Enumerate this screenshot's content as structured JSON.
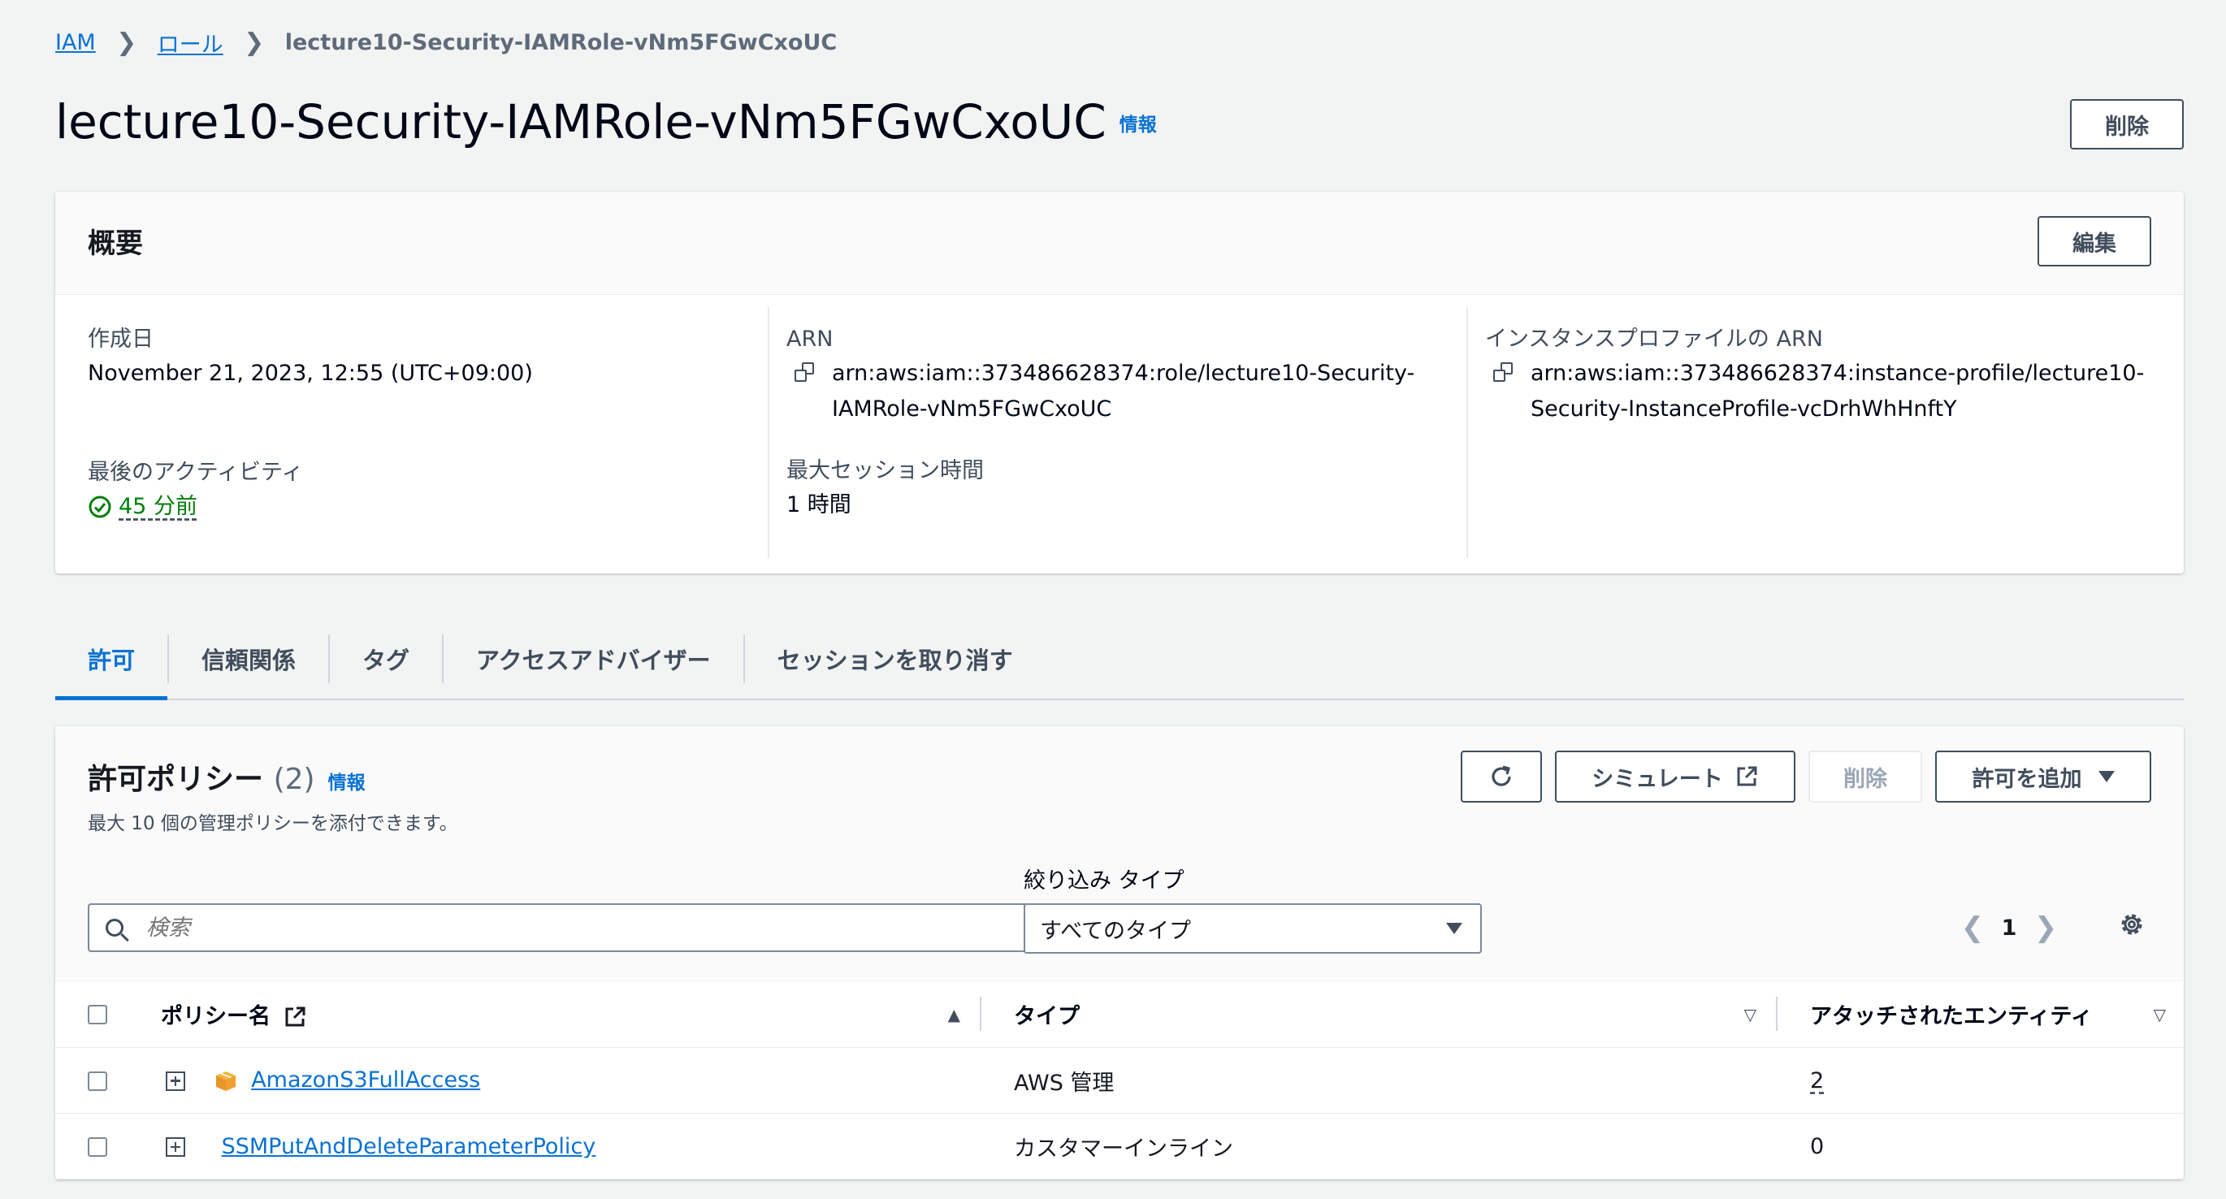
{
  "breadcrumb": {
    "items": [
      "IAM",
      "ロール"
    ],
    "current": "lecture10-Security-IAMRole-vNm5FGwCxoUC"
  },
  "page": {
    "title": "lecture10-Security-IAMRole-vNm5FGwCxoUC",
    "info": "情報",
    "delete_label": "削除"
  },
  "summary": {
    "title": "概要",
    "edit_label": "編集",
    "created_label": "作成日",
    "created_value": "November 21, 2023, 12:55 (UTC+09:00)",
    "last_activity_label": "最後のアクティビティ",
    "last_activity_value": "45 分前",
    "arn_label": "ARN",
    "arn_line1": "arn:aws:iam::373486628374:role/lecture10-Security-",
    "arn_line2": "IAMRole-vNm5FGwCxoUC",
    "max_session_label": "最大セッション時間",
    "max_session_value": "1 時間",
    "instance_arn_label": "インスタンスプロファイルの ARN",
    "instance_arn_line1": "arn:aws:iam::373486628374:instance-profile/lecture10-",
    "instance_arn_line2": "Security-InstanceProfile-vcDrhWhHnftY"
  },
  "tabs": [
    "許可",
    "信頼関係",
    "タグ",
    "アクセスアドバイザー",
    "セッションを取り消す"
  ],
  "policies": {
    "title": "許可ポリシー",
    "count": "(2)",
    "info": "情報",
    "description": "最大 10 個の管理ポリシーを添付できます。",
    "simulate_label": "シミュレート",
    "delete_label": "削除",
    "add_label": "許可を追加",
    "search_placeholder": "検索",
    "filter_label": "絞り込み タイプ",
    "filter_value": "すべてのタイプ",
    "page": "1",
    "columns": {
      "name": "ポリシー名",
      "type": "タイプ",
      "entities": "アタッチされたエンティティ"
    },
    "rows": [
      {
        "name": "AmazonS3FullAccess",
        "type": "AWS 管理",
        "entities": "2"
      },
      {
        "name": "SSMPutAndDeleteParameterPolicy",
        "type": "カスタマーインライン",
        "entities": "0"
      }
    ]
  },
  "colors": {
    "accent": "#0972d3",
    "success": "#037f0c",
    "text": "#16191f",
    "aws_orange": "#f0a030"
  }
}
